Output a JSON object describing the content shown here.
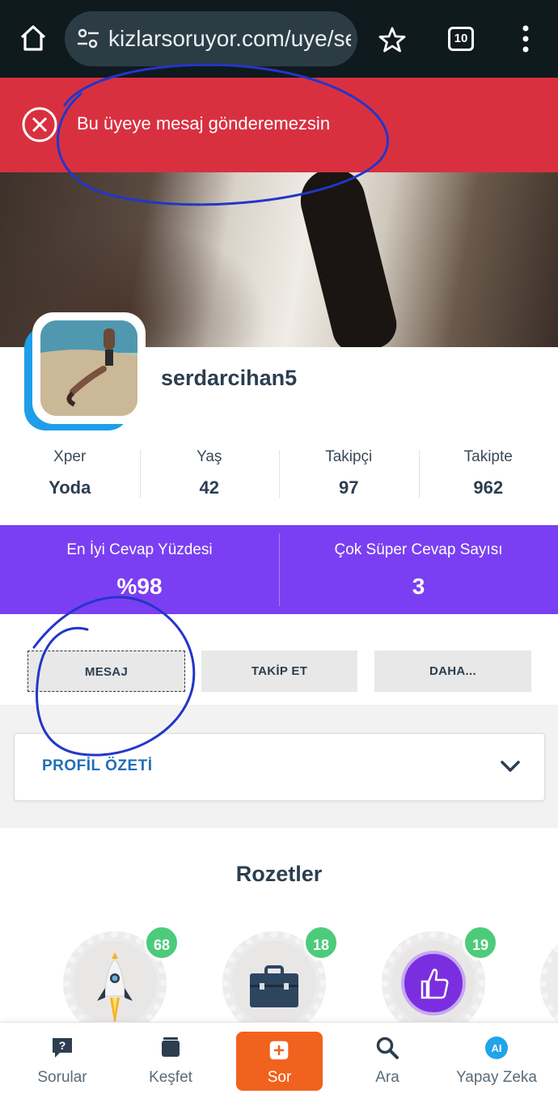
{
  "browser": {
    "url": "kizlarsoruyor.com/uye/se",
    "tab_count": "10"
  },
  "banner": {
    "message": "Bu üyeye mesaj gönderemezsin"
  },
  "profile": {
    "username": "serdarcihan5",
    "stats": [
      {
        "label": "Xper",
        "value": "Yoda"
      },
      {
        "label": "Yaş",
        "value": "42"
      },
      {
        "label": "Takipçi",
        "value": "97"
      },
      {
        "label": "Takipte",
        "value": "962"
      }
    ],
    "highlights": [
      {
        "label": "En İyi Cevap Yüzdesi",
        "value": "%98"
      },
      {
        "label": "Çok Süper Cevap Sayısı",
        "value": "3"
      }
    ],
    "accent_color": "#7a3ff2"
  },
  "actions": {
    "message_label": "MESAJ",
    "follow_label": "TAKİP ET",
    "more_label": "DAHA..."
  },
  "summary": {
    "title": "PROFİL ÖZETİ"
  },
  "badges": {
    "heading": "Rozetler",
    "items": [
      {
        "icon": "rocket-icon",
        "count": "68"
      },
      {
        "icon": "briefcase-icon",
        "count": "18"
      },
      {
        "icon": "thumbs-up-icon",
        "count": "19"
      }
    ]
  },
  "bottom_nav": {
    "items": [
      {
        "label": "Sorular",
        "icon": "question-icon"
      },
      {
        "label": "Keşfet",
        "icon": "explore-icon"
      },
      {
        "label": "Sor",
        "icon": "plus-icon"
      },
      {
        "label": "Ara",
        "icon": "search-icon"
      },
      {
        "label": "Yapay Zeka",
        "icon": "ai-icon"
      }
    ]
  },
  "colors": {
    "error": "#d93040",
    "primary_link": "#1f6fb8",
    "ask_button": "#f0621e",
    "badge_count": "#4ccc7a"
  }
}
